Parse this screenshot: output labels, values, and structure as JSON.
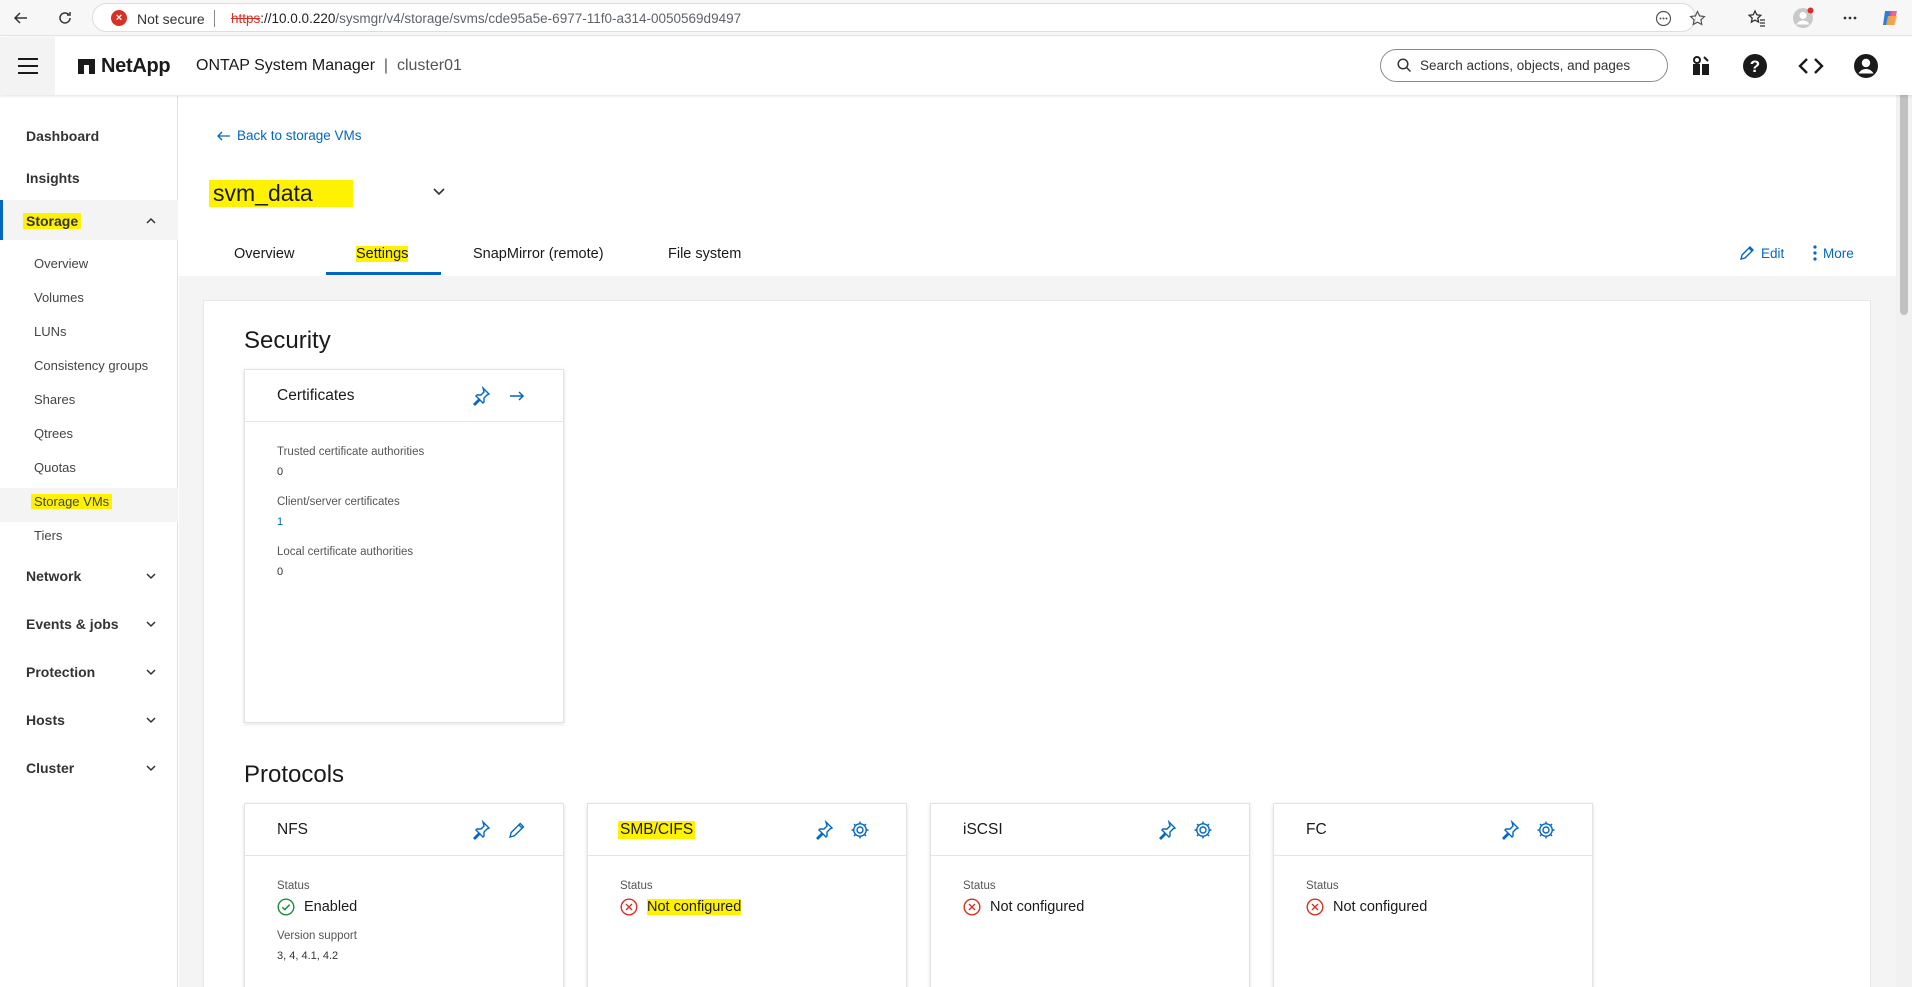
{
  "browser": {
    "not_secure": "Not secure",
    "url_protocol": "https",
    "url_host": "://10.0.0.220",
    "url_path": "/sysmgr/v4/storage/svms/cde95a5e-6977-11f0-a314-0050569d9497"
  },
  "header": {
    "brand": "NetApp",
    "product": "ONTAP System Manager",
    "separator": "|",
    "cluster": "cluster01",
    "search_placeholder": "Search actions, objects, and pages"
  },
  "sidebar": {
    "dashboard": "Dashboard",
    "insights": "Insights",
    "storage": "Storage",
    "storage_items": [
      "Overview",
      "Volumes",
      "LUNs",
      "Consistency groups",
      "Shares",
      "Qtrees",
      "Quotas",
      "Storage VMs",
      "Tiers"
    ],
    "network": "Network",
    "events": "Events & jobs",
    "protection": "Protection",
    "hosts": "Hosts",
    "cluster": "Cluster"
  },
  "main": {
    "back_link": "Back to storage VMs",
    "svm_name": "svm_data",
    "tabs": [
      "Overview",
      "Settings",
      "SnapMirror (remote)",
      "File system"
    ],
    "active_tab": "Settings",
    "edit": "Edit",
    "more": "More",
    "security": {
      "heading": "Security",
      "certificates": {
        "title": "Certificates",
        "trusted_label": "Trusted certificate authorities",
        "trusted_value": "0",
        "client_label": "Client/server certificates",
        "client_value": "1",
        "local_label": "Local certificate authorities",
        "local_value": "0"
      }
    },
    "protocols": {
      "heading": "Protocols",
      "status_label": "Status",
      "nfs": {
        "title": "NFS",
        "status": "Enabled",
        "version_label": "Version support",
        "version_value": "3, 4, 4.1, 4.2"
      },
      "smb": {
        "title": "SMB/CIFS",
        "status": "Not configured"
      },
      "iscsi": {
        "title": "iSCSI",
        "status": "Not configured"
      },
      "fc": {
        "title": "FC",
        "status": "Not configured"
      }
    }
  },
  "colors": {
    "accent": "#0067c5",
    "highlight": "#fff200",
    "error": "#d93025",
    "success": "#1e8e3e"
  }
}
